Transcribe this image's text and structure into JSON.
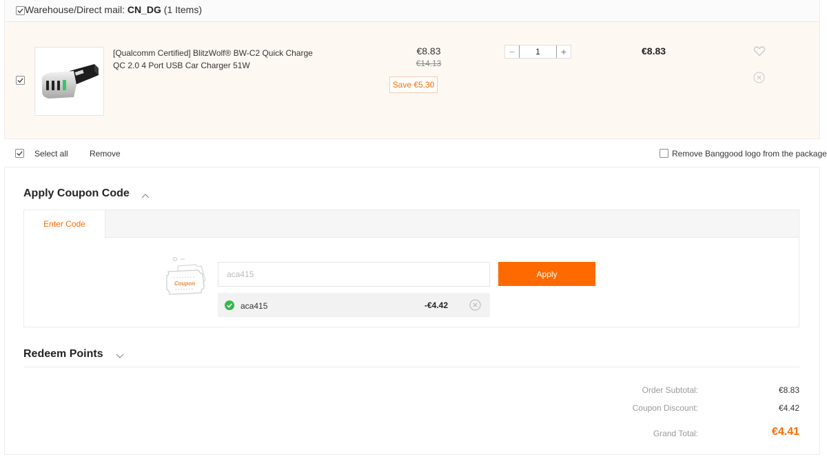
{
  "colors": {
    "accent": "#ff6a00",
    "row_bg": "#fef8f3"
  },
  "warehouse": {
    "label": "Warehouse/Direct mail:",
    "code": "CN_DG",
    "count": "(1 Items)",
    "checked": true
  },
  "item": {
    "checked": true,
    "image_icon": "usb-car-charger-image",
    "name": "[Qualcomm Certified] BlitzWolf® BW-C2 Quick Charge QC 2.0 4 Port USB Car Charger 51W",
    "price": "€8.83",
    "old_price": "€14.13",
    "save": "Save €5.30",
    "quantity": "1",
    "minus": "−",
    "plus": "+",
    "total": "€8.83",
    "wishlist_icon": "heart-icon",
    "remove_icon": "close-circle-icon"
  },
  "select_bar": {
    "select_all": "Select all",
    "remove": "Remove",
    "remove_logo": "Remove Banggood logo from the package",
    "remove_logo_checked": false
  },
  "coupon": {
    "heading": "Apply Coupon Code",
    "tab": "Enter Code",
    "input_value": "aca415",
    "apply": "Apply",
    "applied_code": "aca415",
    "applied_discount": "-€4.42"
  },
  "redeem": {
    "heading": "Redeem Points"
  },
  "summary": {
    "subtotal_label": "Order Subtotal:",
    "subtotal_value": "€8.83",
    "discount_label": "Coupon Discount:",
    "discount_value": "€4.42",
    "grand_label": "Grand Total:",
    "grand_value": "€4.41"
  }
}
